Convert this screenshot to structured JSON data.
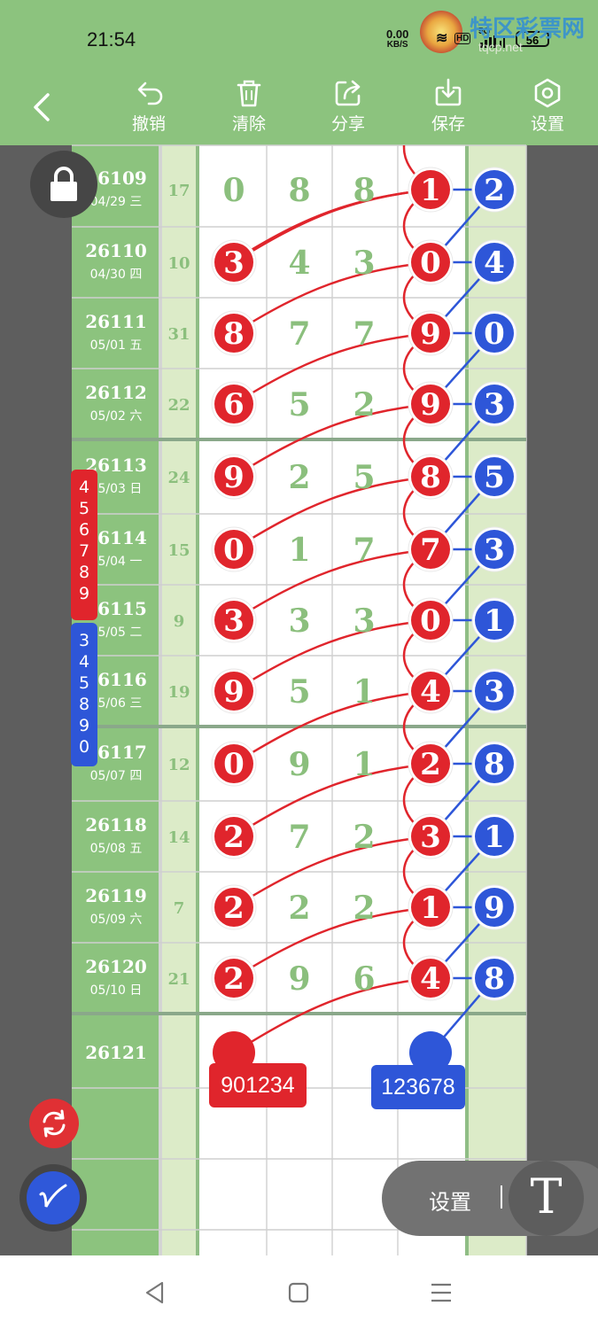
{
  "status_bar": {
    "time": "21:54",
    "net_speed_value": "0.00",
    "net_speed_unit": "KB/S",
    "hd": "HD",
    "five_g": "5G",
    "battery": "56"
  },
  "watermark": {
    "text": "特区彩票网",
    "url": "tqcp.net"
  },
  "toolbar": {
    "undo_label": "撤销",
    "clear_label": "清除",
    "share_label": "分享",
    "save_label": "保存",
    "settings_label": "设置"
  },
  "table": {
    "rows": [
      {
        "period": "26109",
        "date": "04/29 三",
        "sum": "17",
        "digits": [
          "0",
          "8",
          "8",
          "1"
        ],
        "diff": "2"
      },
      {
        "period": "26110",
        "date": "04/30 四",
        "sum": "10",
        "digits": [
          "3",
          "4",
          "3",
          "0"
        ],
        "diff": "4"
      },
      {
        "period": "26111",
        "date": "05/01 五",
        "sum": "31",
        "digits": [
          "8",
          "7",
          "7",
          "9"
        ],
        "diff": "0"
      },
      {
        "period": "26112",
        "date": "05/02 六",
        "sum": "22",
        "digits": [
          "6",
          "5",
          "2",
          "9"
        ],
        "diff": "3"
      },
      {
        "period": "26113",
        "date": "05/03 日",
        "sum": "24",
        "digits": [
          "9",
          "2",
          "5",
          "8"
        ],
        "diff": "5"
      },
      {
        "period": "26114",
        "date": "05/04 一",
        "sum": "15",
        "digits": [
          "0",
          "1",
          "7",
          "7"
        ],
        "diff": "3"
      },
      {
        "period": "26115",
        "date": "05/05 二",
        "sum": "9",
        "digits": [
          "3",
          "3",
          "3",
          "0"
        ],
        "diff": "1"
      },
      {
        "period": "26116",
        "date": "05/06 三",
        "sum": "19",
        "digits": [
          "9",
          "5",
          "1",
          "4"
        ],
        "diff": "3"
      },
      {
        "period": "26117",
        "date": "05/07 四",
        "sum": "12",
        "digits": [
          "0",
          "9",
          "1",
          "2"
        ],
        "diff": "8"
      },
      {
        "period": "26118",
        "date": "05/08 五",
        "sum": "14",
        "digits": [
          "2",
          "7",
          "2",
          "3"
        ],
        "diff": "1"
      },
      {
        "period": "26119",
        "date": "05/09 六",
        "sum": "7",
        "digits": [
          "2",
          "2",
          "2",
          "1"
        ],
        "diff": "9"
      },
      {
        "period": "26120",
        "date": "05/10 日",
        "sum": "21",
        "digits": [
          "2",
          "9",
          "6",
          "4"
        ],
        "diff": "8"
      }
    ],
    "next_period": "26121"
  },
  "predictions": {
    "red_label": "901234",
    "blue_label": "123678"
  },
  "side_badges": {
    "red": [
      "4",
      "5",
      "6",
      "7",
      "8",
      "9"
    ],
    "blue": [
      "3",
      "4",
      "5",
      "8",
      "9",
      "0"
    ]
  },
  "floating": {
    "settings_label": "设置",
    "text_tool": "T"
  },
  "colors": {
    "header_green": "#8cc37e",
    "red_ball": "#e0252c",
    "blue_ball": "#2e56d8",
    "digit_green": "#8bbf7d"
  }
}
